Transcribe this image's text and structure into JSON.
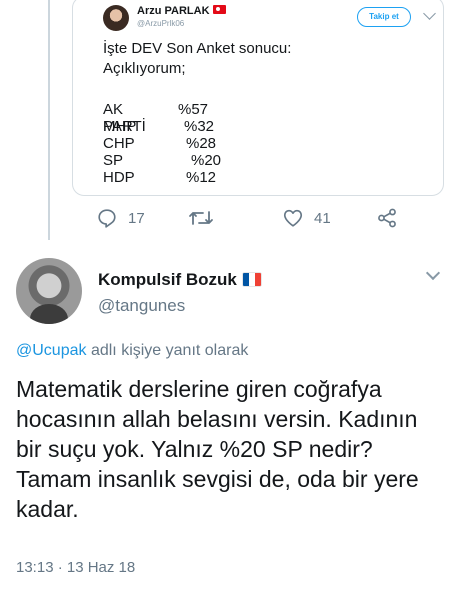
{
  "quoted_tweet": {
    "author_name": "Arzu PARLAK",
    "author_handle": "@ArzuPrlk06",
    "follow_label": "Takip et",
    "text_lines": [
      "İşte DEV Son Anket sonucu:",
      "Açıklıyorum;"
    ],
    "results": [
      {
        "party": "AK PARTİ",
        "value": "%57"
      },
      {
        "party": "MHP",
        "value": "%32"
      },
      {
        "party": "CHP",
        "value": "%28"
      },
      {
        "party": "SP",
        "value": "%20"
      },
      {
        "party": "HDP",
        "value": "%12"
      }
    ]
  },
  "actions": {
    "reply_count": "17",
    "retweet_count": "",
    "like_count": "41"
  },
  "tweet": {
    "author_name": "Kompulsif Bozuk",
    "author_handle": "@tangunes",
    "reply_mention": "@Ucupak",
    "reply_suffix": " adlı kişiye yanıt olarak",
    "body": "Matematik derslerine giren coğrafya hocasının allah belasını versin. Kadının bir suçu yok. Yalnız %20 SP nedir? Tamam insanlık sevgisi de, oda bir yere kadar.",
    "timestamp": "13:13 · 13 Haz 18"
  },
  "colors": {
    "link": "#1b95e0",
    "muted": "#657786",
    "follow_accent": "#1da1f2"
  },
  "icons": [
    "reply-icon",
    "retweet-icon",
    "like-icon",
    "share-icon",
    "chevron-down-icon"
  ]
}
